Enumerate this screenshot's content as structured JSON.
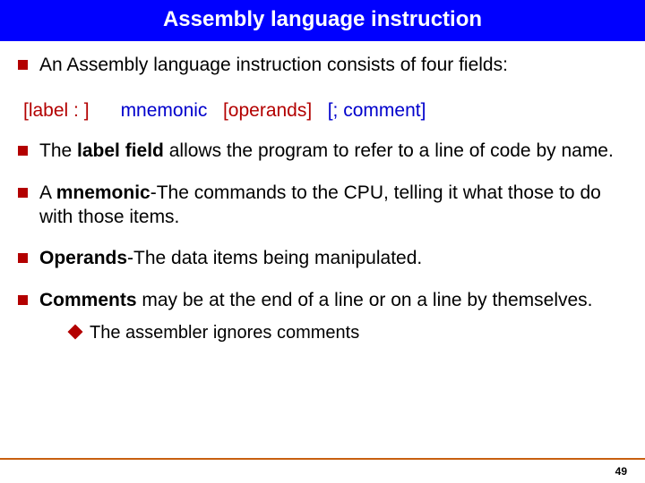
{
  "title": "Assembly language instruction",
  "bullets": {
    "b1": "An Assembly language instruction consists of four fields:",
    "b2_pre": "The ",
    "b2_bold": "label field",
    "b2_post": " allows the program to refer to a line of code by name.",
    "b3_pre": "A ",
    "b3_bold": "mnemonic",
    "b3_post": "-The commands to the CPU, telling it what those to do with those items.",
    "b4_bold": "Operands",
    "b4_post": "-The data items being manipulated.",
    "b5_bold": "Comments",
    "b5_post": " may be at the end of a line or on a line by themselves.",
    "sub1": "The assembler ignores comments"
  },
  "syntax": {
    "label": "[label : ]",
    "mnemonic": "mnemonic",
    "operands": "[operands]",
    "comment": "[; comment]"
  },
  "page_number": "49"
}
